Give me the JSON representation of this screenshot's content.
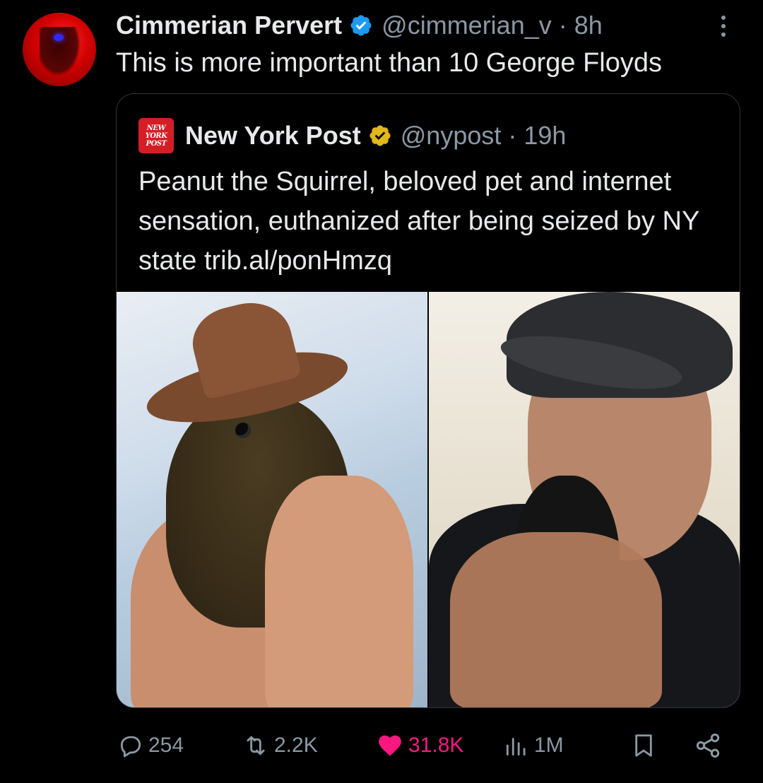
{
  "tweet": {
    "author_name": "Cimmerian Pervert",
    "handle_time": "@cimmerian_v · 8h",
    "text": "This is more important than 10 George Floyds"
  },
  "quoted": {
    "logo_text": [
      "NEW",
      "YORK",
      "POST"
    ],
    "author_name": "New York Post",
    "handle_time": "@nypost · 19h",
    "text": "Peanut the Squirrel, beloved pet and internet sensation, euthanized after being seized by NY state trib.al/ponHmzq"
  },
  "actions": {
    "replies": "254",
    "reposts": "2.2K",
    "likes": "31.8K",
    "views": "1M"
  },
  "icons": {
    "reply": "reply-icon",
    "repost": "repost-icon",
    "like": "heart-icon",
    "views": "views-icon",
    "bookmark": "bookmark-icon",
    "share": "share-icon",
    "more": "more-icon",
    "verified": "verified-badge-icon"
  },
  "colors": {
    "background": "#000000",
    "text": "#e7e9ea",
    "muted": "#8b98a5",
    "verified_blue": "#1d9bf0",
    "verified_gold": "#e2b719",
    "like_pink": "#f91880",
    "nyp_red": "#d41e25"
  }
}
